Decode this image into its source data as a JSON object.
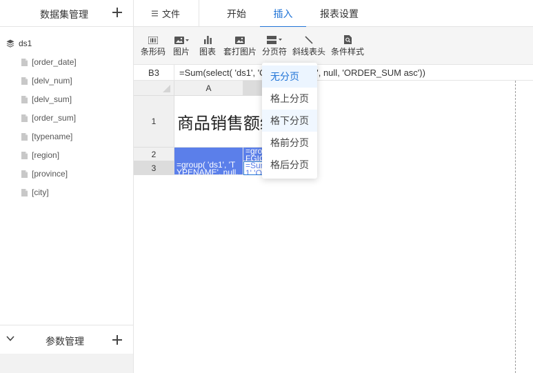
{
  "left_panel": {
    "dataset_title": "数据集管理",
    "tree": {
      "root": "ds1",
      "fields": [
        "[order_date]",
        "[delv_num]",
        "[delv_sum]",
        "[order_sum]",
        "[typename]",
        "[region]",
        "[province]",
        "[city]"
      ]
    },
    "param_title": "参数管理"
  },
  "tabs": {
    "file": "文件",
    "items": [
      "开始",
      "插入",
      "报表设置"
    ],
    "active": "插入"
  },
  "toolbar": {
    "items": [
      "条形码",
      "图片",
      "图表",
      "套打图片",
      "分页符",
      "斜线表头",
      "条件样式"
    ]
  },
  "formula_bar": {
    "cell_ref": "B3",
    "formula": "=Sum(select( 'ds1', 'ORDER_SUM', null, 'ORDER_SUM asc'))"
  },
  "grid": {
    "col_a": "A",
    "rows": [
      "1",
      "2",
      "3"
    ],
    "title_text": "商品销售额统计",
    "a3_line1": "=group( 'ds1', 'T",
    "a3_line2": "YPENAME', null,",
    "b2_line1": "=gro",
    "b2_line2": "FGIO",
    "b3_line1": "=Sum",
    "b3_line2": "1' 'O"
  },
  "dropdown": {
    "items": [
      "无分页",
      "格上分页",
      "格下分页",
      "格前分页",
      "格后分页"
    ],
    "selected": "无分页",
    "hovered": "格下分页"
  },
  "colors": {
    "accent": "#1f73d6",
    "selection": "#5b7fea",
    "toolbar_bg": "#f5f5f5"
  }
}
